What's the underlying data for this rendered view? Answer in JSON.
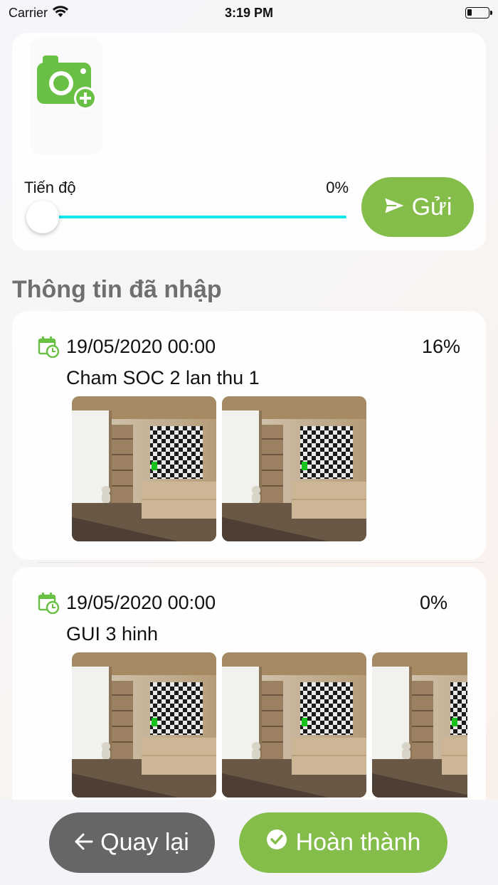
{
  "status_bar": {
    "carrier": "Carrier",
    "time": "3:19 PM"
  },
  "upload": {
    "progress_label": "Tiến độ",
    "progress_value": 0,
    "progress_text": "0%",
    "send_label": "Gửi"
  },
  "section_title": "Thông tin đã nhập",
  "entries": [
    {
      "date": "19/05/2020 00:00",
      "percent": "16%",
      "name": "Cham SOC 2 lan thu 1",
      "image_count": 2
    },
    {
      "date": "19/05/2020 00:00",
      "percent": "0%",
      "name": "GUI 3 hinh",
      "image_count": 3
    }
  ],
  "footer": {
    "back_label": "Quay lại",
    "done_label": "Hoàn thành"
  },
  "colors": {
    "accent_green": "#84bd4a",
    "slider_cyan": "#10e6ef",
    "back_gray": "#666666",
    "title_gray": "#6f6f6f"
  },
  "icons": [
    "wifi-icon",
    "battery-icon",
    "camera-add-icon",
    "send-icon",
    "calendar-clock-icon",
    "arrow-left-icon",
    "check-circle-icon"
  ]
}
